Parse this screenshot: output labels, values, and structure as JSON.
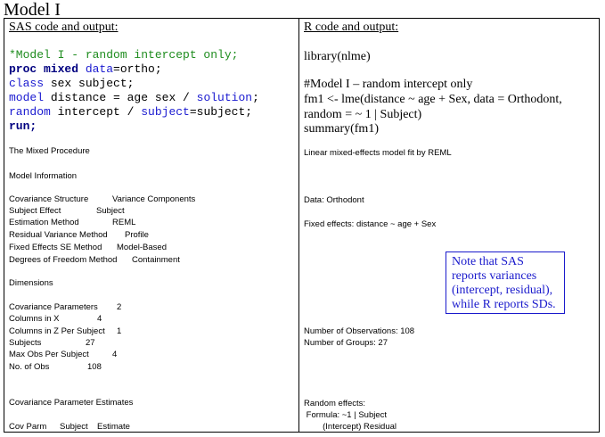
{
  "title": "Model I",
  "sas": {
    "heading": "SAS code and output:",
    "code": {
      "comment": "*Model I - random intercept only;",
      "line2_kw": "proc mixed",
      "line2_opt": "data",
      "line2_val": "=ortho;",
      "line3_kw": "class",
      "line3_rest": " sex subject;",
      "line4_kw": "model",
      "line4_rest": " distance = age sex / ",
      "line4_opt": "solution",
      "line4_end": ";",
      "line5_kw": "random",
      "line5_rest": " intercept / ",
      "line5_opt": "subject",
      "line5_end": "=subject;",
      "line6_kw": "run;"
    },
    "output": {
      "procedure": "The Mixed Procedure",
      "model_info_title": "Model Information",
      "model_info": [
        {
          "key": "Covariance Structure",
          "value": "Variance Components"
        },
        {
          "key": "Subject Effect",
          "value": "Subject"
        },
        {
          "key": "Estimation Method",
          "value": "REML"
        },
        {
          "key": "Residual Variance Method",
          "value": "Profile"
        },
        {
          "key": "Fixed Effects SE Method",
          "value": "Model-Based"
        },
        {
          "key": "Degrees of Freedom Method",
          "value": "Containment"
        }
      ],
      "dimensions_title": "Dimensions",
      "dimensions": [
        {
          "key": "Covariance Parameters",
          "value": "2"
        },
        {
          "key": "Columns in X",
          "value": "4"
        },
        {
          "key": "Columns in Z Per Subject",
          "value": "1"
        },
        {
          "key": "Subjects",
          "value": "27"
        },
        {
          "key": "Max Obs Per Subject",
          "value": "4"
        },
        {
          "key": "No. of Obs",
          "value": "108"
        }
      ],
      "cov_title": "Covariance Parameter Estimates",
      "cov_headers": [
        "Cov Parm",
        "Subject",
        "Estimate"
      ]
    }
  },
  "r": {
    "heading": "R code and output:",
    "code": [
      "library(nlme)",
      "#Model I – random intercept only",
      "fm1 <- lme(distance ~ age + Sex, data = Orthodont,",
      "random = ~ 1 | Subject)",
      "summary(fm1)"
    ],
    "output": {
      "fit": "Linear mixed-effects model fit by REML",
      "data": "Data: Orthodont",
      "fixed": "Fixed effects: distance ~ age + Sex",
      "n_obs": "Number of Observations: 108",
      "n_groups": "Number of Groups: 27",
      "random": "Random effects:",
      "formula": " Formula: ~1 | Subject",
      "random_header": "        (Intercept) Residual"
    }
  },
  "note": "Note that SAS reports variances (intercept, residual), while R reports SDs."
}
